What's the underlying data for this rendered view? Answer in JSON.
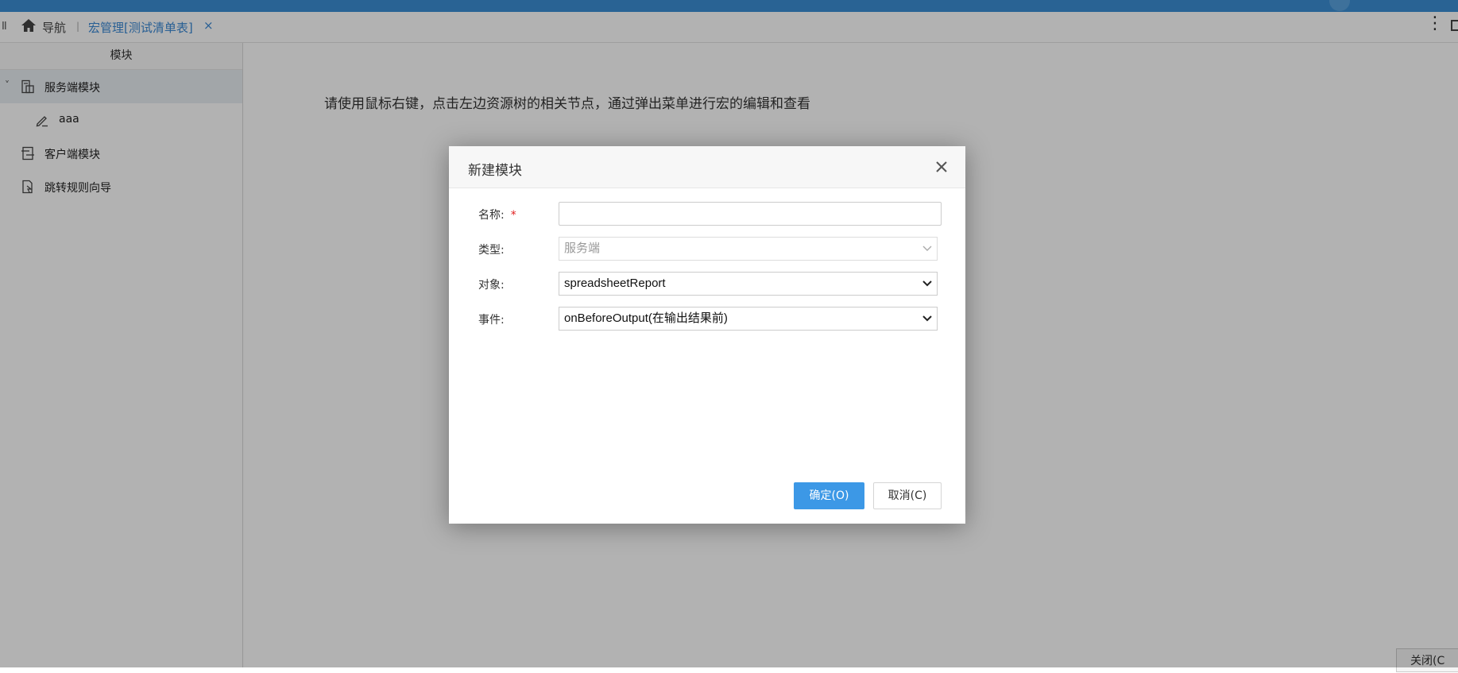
{
  "tabbar": {
    "grip": "II",
    "nav_label": "导航",
    "separator": "|",
    "active_tab": "宏管理[测试清单表]",
    "tab_close": "×",
    "more": "⋮"
  },
  "sidebar": {
    "header": "模块",
    "items": [
      {
        "label": "服务端模块",
        "icon": "server-module-icon",
        "expanded": true,
        "toggle": "˅"
      },
      {
        "label": "aaa",
        "icon": "edit-pen-icon"
      },
      {
        "label": "客户端模块",
        "icon": "client-module-icon"
      },
      {
        "label": "跳转规则向导",
        "icon": "redirect-rule-icon"
      }
    ]
  },
  "main": {
    "hint": "请使用鼠标右键，点击左边资源树的相关节点，通过弹出菜单进行宏的编辑和查看"
  },
  "corner_close": "关闭(C",
  "dialog": {
    "title": "新建模块",
    "close_icon": "close-icon",
    "fields": {
      "name_label": "名称:",
      "name_required": "*",
      "name_value": "",
      "type_label": "类型:",
      "type_value": "服务端",
      "object_label": "对象:",
      "object_value": "spreadsheetReport",
      "event_label": "事件:",
      "event_value": "onBeforeOutput(在输出结果前)"
    },
    "ok_label": "确定(O)",
    "cancel_label": "取消(C)"
  },
  "colors": {
    "topbar": "#3c8ed4",
    "accent": "#3c98e6",
    "link": "#3a88d4",
    "required": "#e02020"
  }
}
